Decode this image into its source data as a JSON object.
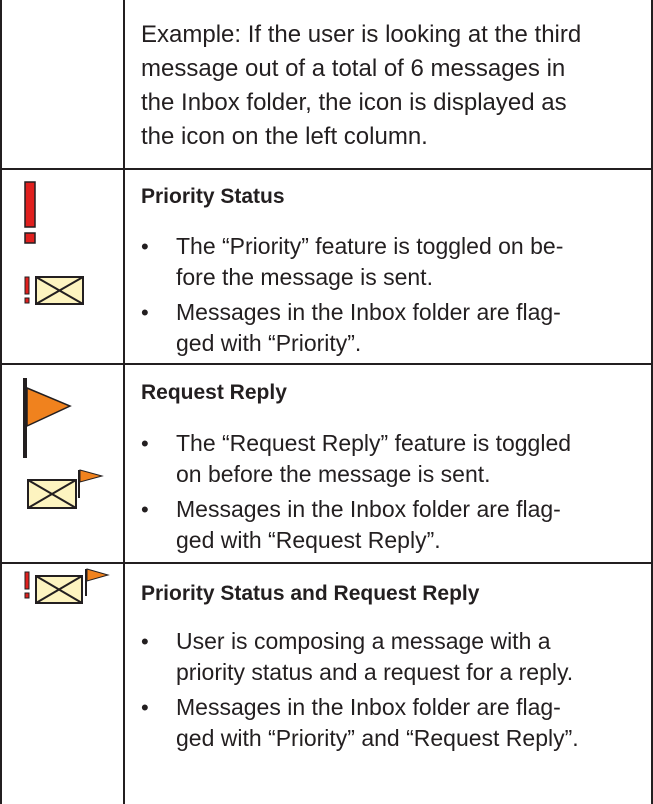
{
  "intro": {
    "text_lines": [
      "Example: If the user is looking at the third",
      "message out of a total of 6 messages in",
      "the Inbox folder, the icon is displayed as",
      "the icon on the left column."
    ]
  },
  "rows": [
    {
      "title": "Priority Status",
      "icons": [
        "priority-exclamation-icon",
        "priority-envelope-icon"
      ],
      "bullets": [
        [
          "The “Priority” feature is toggled on be-",
          "fore the message is sent."
        ],
        [
          "Messages in the Inbox folder are flag-",
          "ged with “Priority”."
        ]
      ]
    },
    {
      "title": "Request Reply",
      "icons": [
        "request-reply-flag-icon",
        "request-reply-envelope-icon"
      ],
      "bullets": [
        [
          "The “Request Reply” feature is toggled",
          "on before the message is sent."
        ],
        [
          "Messages in the Inbox folder are flag-",
          "ged with “Request Reply”."
        ]
      ]
    },
    {
      "title": "Priority Status and Request Reply",
      "icons": [
        "priority-request-reply-envelope-icon"
      ],
      "bullets": [
        [
          "User is composing a message with a",
          "priority status and a request for a reply."
        ],
        [
          "Messages in the Inbox folder are flag-",
          "ged with “Priority” and “Request Reply”."
        ]
      ]
    }
  ],
  "bullet_char": "•",
  "colors": {
    "priority_red": "#e0201e",
    "flag_orange": "#f0821e",
    "envelope_fill": "#fdf4c0",
    "line": "#231f20"
  }
}
